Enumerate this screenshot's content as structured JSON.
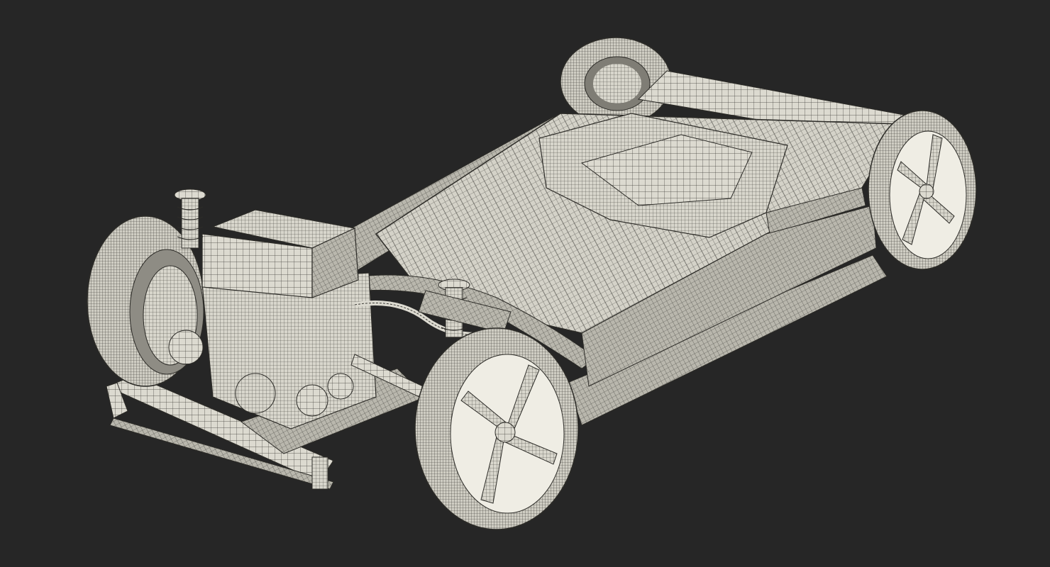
{
  "scene": {
    "subject": "wireframe-chassis",
    "colors": {
      "background": "#262626",
      "surface": "#dcdad0",
      "surface_shade": "#b9b7ad",
      "surface_dark": "#8e8c84",
      "wire": "#3c3b37",
      "rim": "#efede4"
    }
  }
}
